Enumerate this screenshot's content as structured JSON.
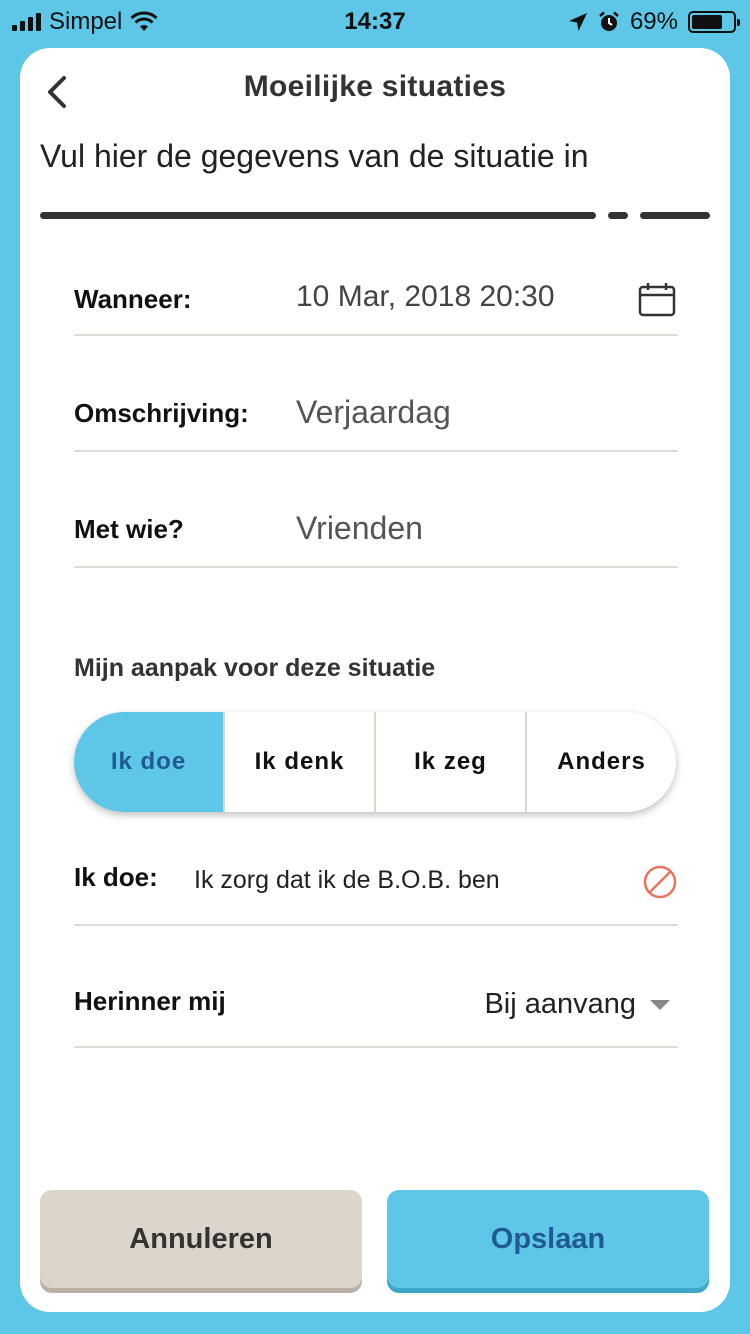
{
  "status_bar": {
    "carrier": "Simpel",
    "time": "14:37",
    "battery": "69%",
    "battery_level": 0.69,
    "icons": [
      "signal-icon",
      "wifi-icon",
      "location-icon",
      "alarm-icon",
      "battery-icon"
    ]
  },
  "header": {
    "title": "Moeilijke situaties",
    "back_icon": "chevron-left-icon"
  },
  "subtitle": "Vul hier de gegevens van de situatie in",
  "form": {
    "wanneer": {
      "label": "Wanneer:",
      "value": "10 Mar, 2018 20:30",
      "icon": "calendar-icon"
    },
    "omschrijving": {
      "label": "Omschrijving:",
      "value": "Verjaardag"
    },
    "met_wie": {
      "label": "Met wie?",
      "value": "Vrienden"
    }
  },
  "approach": {
    "title": "Mijn aanpak voor deze situatie",
    "options": [
      "Ik doe",
      "Ik denk",
      "Ik zeg",
      "Anders"
    ],
    "selected": "Ik doe",
    "entry_label": "Ik doe:",
    "entry_value": "Ik zorg dat ik de B.O.B. ben",
    "clear_icon": "clear-icon"
  },
  "reminder": {
    "label": "Herinner mij",
    "value": "Bij aanvang",
    "icon": "caret-down-icon"
  },
  "buttons": {
    "cancel": "Annuleren",
    "save": "Opslaan"
  },
  "colors": {
    "accent": "#5ec6e6",
    "accent_text": "#1f5a95",
    "cancel_bg": "#dcd5cc",
    "clear_icon": "#e8745e"
  }
}
